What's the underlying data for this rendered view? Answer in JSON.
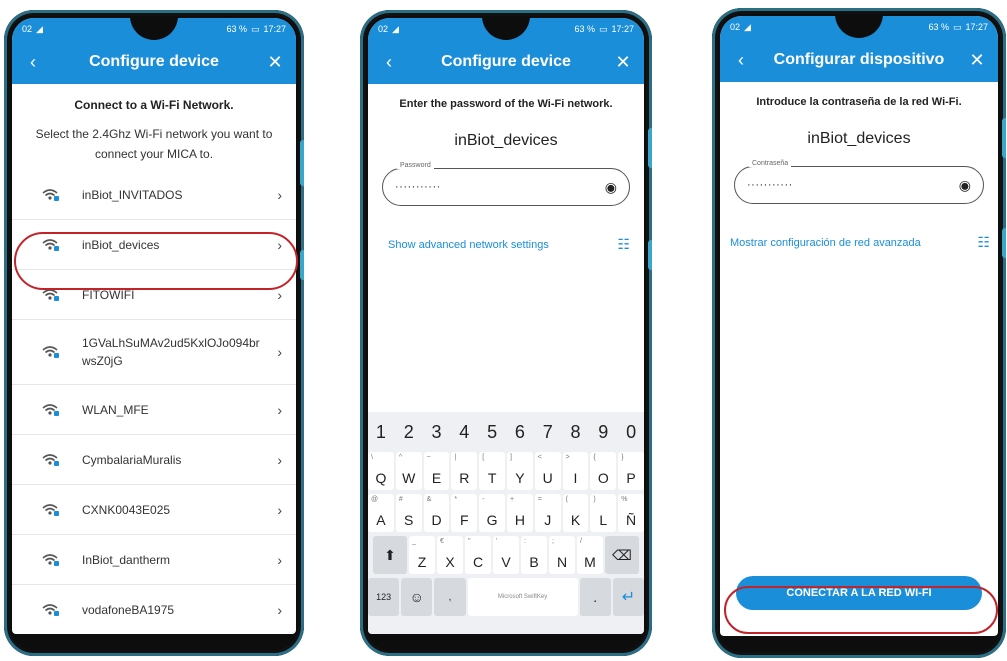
{
  "status": {
    "time": "17:27",
    "battery": "63 %",
    "left": "02"
  },
  "screen1": {
    "title": "Configure device",
    "heading": "Connect to a Wi-Fi Network.",
    "subtitle": "Select the 2.4Ghz Wi-Fi network you want to connect your MICA to.",
    "networks": [
      "inBiot_INVITADOS",
      "inBiot_devices",
      "FITOWIFI",
      "1GVaLhSuMAv2ud5KxlOJo094brwsZ0jG",
      "WLAN_MFE",
      "CymbalariaMuralis",
      "CXNK0043E025",
      "InBiot_dantherm",
      "vodafoneBA1975"
    ]
  },
  "screen2": {
    "title": "Configure device",
    "heading": "Enter the password of the Wi-Fi network.",
    "network": "inBiot_devices",
    "password_label": "Password",
    "password_value": "···········",
    "advanced": "Show advanced network settings",
    "keyboard": {
      "numbers": [
        "1",
        "2",
        "3",
        "4",
        "5",
        "6",
        "7",
        "8",
        "9",
        "0"
      ],
      "row1": [
        [
          "\\",
          "Q"
        ],
        [
          "^",
          "W"
        ],
        [
          "~",
          "E"
        ],
        [
          "|",
          "R"
        ],
        [
          "[",
          "T"
        ],
        [
          "]",
          "Y"
        ],
        [
          "<",
          "U"
        ],
        [
          ">",
          "I"
        ],
        [
          "{",
          "O"
        ],
        [
          "}",
          "P"
        ]
      ],
      "row2": [
        [
          "@",
          "A"
        ],
        [
          "#",
          "S"
        ],
        [
          "&",
          "D"
        ],
        [
          "*",
          "F"
        ],
        [
          "-",
          "G"
        ],
        [
          "+",
          "H"
        ],
        [
          "=",
          "J"
        ],
        [
          "(",
          "K"
        ],
        [
          ")",
          "L"
        ],
        [
          "%",
          "Ñ"
        ]
      ],
      "row3": [
        [
          "_",
          "Z"
        ],
        [
          "€",
          "X"
        ],
        [
          "\"",
          "C"
        ],
        [
          "'",
          "V"
        ],
        [
          ":",
          "B"
        ],
        [
          ";",
          "N"
        ],
        [
          "/",
          "M"
        ]
      ],
      "sym": "123",
      "space": "Microsoft SwiftKey"
    }
  },
  "screen3": {
    "title": "Configurar dispositivo",
    "heading": "Introduce la contraseña de la red Wi-Fi.",
    "network": "inBiot_devices",
    "password_label": "Contraseña",
    "password_value": "···········",
    "advanced": "Mostrar configuración de red avanzada",
    "connect": "CONECTAR A LA RED WI-FI"
  },
  "colors": {
    "primary": "#1a8ed8",
    "highlight": "#c0242a"
  }
}
